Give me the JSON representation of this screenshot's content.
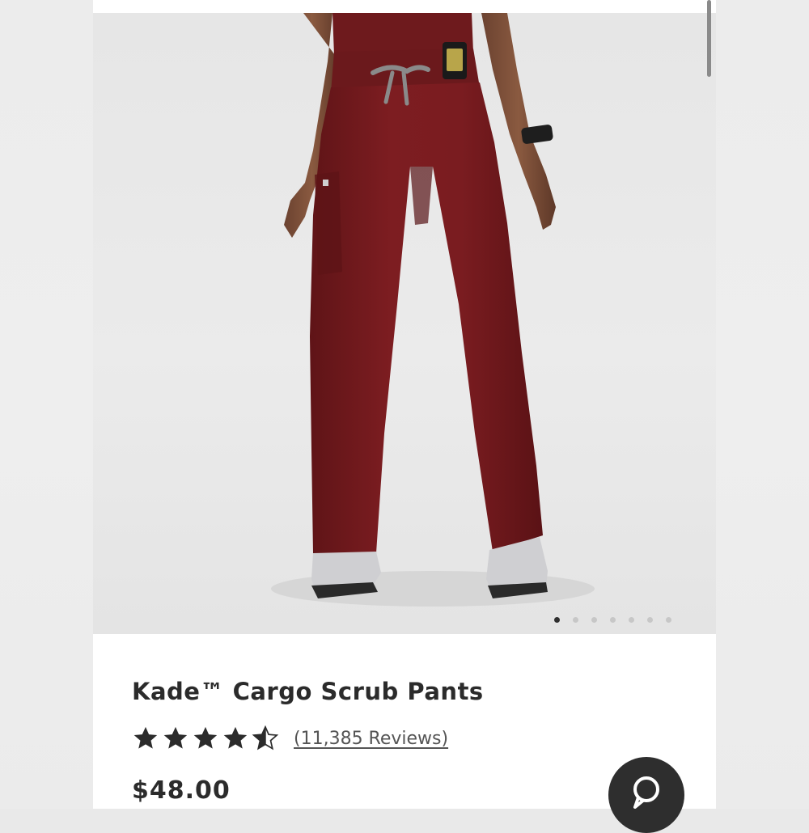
{
  "product": {
    "title": "Kade™ Cargo Scrub Pants",
    "rating_value": 4.5,
    "rating_max": 5,
    "reviews_label": "(11,385 Reviews)",
    "price": "$48.00"
  },
  "gallery": {
    "image_count": 7,
    "active_index": 0
  },
  "icons": {
    "star": "star-icon",
    "half_star": "half-star-icon",
    "chat": "chat-icon"
  },
  "colors": {
    "pants": "#7a1c1f",
    "text": "#2b2b2b",
    "dot_active": "#2f2f2f",
    "dot_inactive": "#c7c7c7"
  }
}
